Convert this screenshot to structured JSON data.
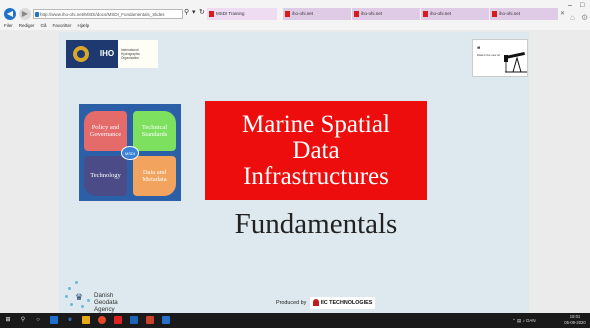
{
  "browser": {
    "address": "http://www.iho-ohi.net/MSDI/docs/MSDI_Fundamentals_Slides",
    "tabs": [
      {
        "label": "MSDI Training",
        "active": true,
        "favicon": "iho-favicon"
      },
      {
        "label": "iho-ohi.net",
        "favicon": "iho-favicon"
      },
      {
        "label": "iho-ohi.net",
        "favicon": "iho-favicon"
      },
      {
        "label": "iho-ohi.net",
        "favicon": "iho-favicon"
      },
      {
        "label": "iho-ohi.net",
        "favicon": "iho-favicon"
      }
    ],
    "menu": [
      "Filer",
      "Rediger",
      "Gå",
      "Favoritter",
      "Hjælp"
    ]
  },
  "slide": {
    "iho": {
      "acronym": "IHO",
      "name": "International Hydrographic Organization"
    },
    "quote_thumb": {
      "quote_mark": "❝",
      "text": "Data is the new oil"
    },
    "diagram": {
      "center": "MSDI",
      "quadrants": {
        "policy": "Policy and Governance",
        "standards": "Technical Standards",
        "technology": "Technology",
        "data": "Data and Metadata"
      }
    },
    "title_lines": [
      "Marine Spatial",
      "Data",
      "Infrastructures"
    ],
    "subtitle": "Fundamentals",
    "dgs": {
      "line1": "Danish Geodata",
      "line2": "Agency"
    },
    "produced": {
      "text": "Produced by",
      "brand": "IIC TECHNOLOGIES"
    }
  },
  "taskbar": {
    "language": "DAN",
    "time": "15:01",
    "date": "05-09-2020"
  },
  "colors": {
    "slide_bg": "#dde9ee",
    "title_red": "#ee0d0d",
    "diagram_blue": "#2b5fa8"
  }
}
